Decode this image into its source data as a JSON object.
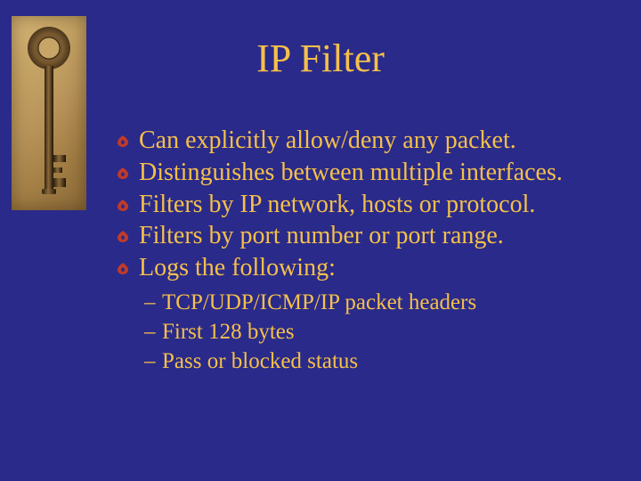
{
  "title": "IP Filter",
  "bullets": [
    "Can explicitly allow/deny any packet.",
    "Distinguishes between multiple interfaces.",
    "Filters by IP network, hosts or protocol.",
    "Filters by port number or port range.",
    "Logs the following:"
  ],
  "sub_bullets": [
    "TCP/UDP/ICMP/IP packet headers",
    "First 128 bytes",
    "Pass or blocked status"
  ],
  "colors": {
    "background": "#2a2a8a",
    "text": "#f5c04a",
    "bullet": "#c03a2a"
  }
}
